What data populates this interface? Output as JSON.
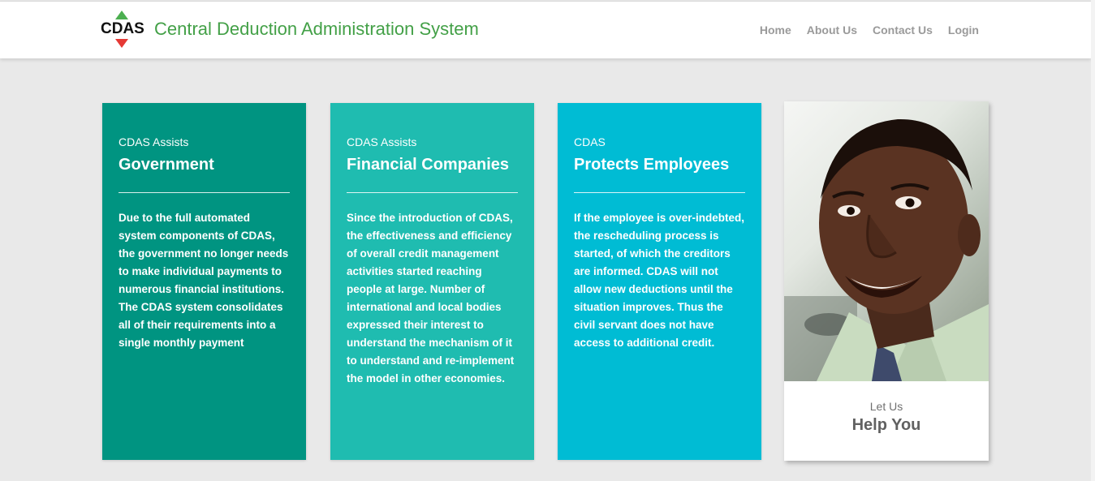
{
  "header": {
    "logo_text": "CDAS",
    "site_title": "Central Deduction Administration System",
    "nav": [
      "Home",
      "About Us",
      "Contact Us",
      "Login"
    ]
  },
  "cards": [
    {
      "kicker": "CDAS Assists",
      "heading": "Government",
      "body": "Due to the full automated system components of CDAS, the government no longer needs to make individual payments to numerous financial institutions. The CDAS system consolidates all of their requirements into a single monthly payment",
      "color": "#009481"
    },
    {
      "kicker": "CDAS Assists",
      "heading": "Financial Companies",
      "body": "Since the introduction of CDAS, the effectiveness and efficiency of overall credit management activities started reaching people at large. Number of international and local bodies expressed their interest to understand the mechanism of it to understand and re-implement the model in other economies.",
      "color": "#1fbcb0"
    },
    {
      "kicker": "CDAS",
      "heading": "Protects Employees",
      "body": "If the employee is over-indebted, the rescheduling process is started, of which the creditors are informed. CDAS will not allow new deductions until the situation improves. Thus the civil servant does not have access to additional credit.",
      "color": "#00bcd4"
    }
  ],
  "help": {
    "kicker": "Let Us",
    "title": "Help You",
    "photo": "smiling-man-photo"
  },
  "colors": {
    "brand_green": "#43a047",
    "logo_red": "#e53935",
    "nav_text": "#9a9a9a",
    "page_bg": "#e9e9e9"
  }
}
